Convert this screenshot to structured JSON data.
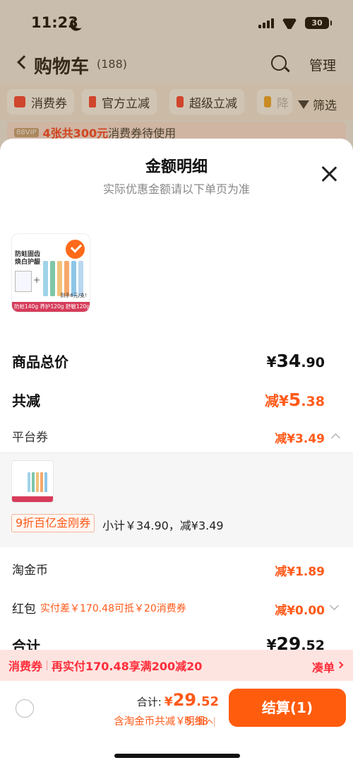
{
  "status_bar": {
    "time": "11:23",
    "battery": "30"
  },
  "nav": {
    "title": "购物车",
    "count": "(188)",
    "manage_label": "管理"
  },
  "filters": [
    {
      "label": "消费券",
      "color": "#ff3b30"
    },
    {
      "label": "官方立减",
      "color": "#ff3b30"
    },
    {
      "label": "超级立减",
      "color": "#ff3b30"
    },
    {
      "label": "降",
      "color": "#f5a623"
    }
  ],
  "filter_button": "筛选",
  "coupon_banner": {
    "vip": "88VIP",
    "highlight": "4张共300元",
    "rest": "消费券待使用"
  },
  "sheet": {
    "title": "金额明细",
    "subtitle": "实际优惠金额请以下单页为准",
    "product_thumb": {
      "headline": "防蛀固齿\n焕白护龈",
      "footer": "防蛀140g 养护120g 舒敏120g",
      "note": "到手6元/支!"
    },
    "product_total": {
      "label": "商品总价",
      "currency": "¥",
      "int": "34",
      "dec": ".90"
    },
    "total_reduce": {
      "label": "共减",
      "prefix": "减¥",
      "int": "5",
      "dec": ".38"
    },
    "platform_coupon": {
      "label": "平台券",
      "value": "减¥3.49"
    },
    "coupon_detail": {
      "tag": "9折百亿金刚券",
      "subtotal": "小计￥34.90，减¥3.49"
    },
    "taojinbi": {
      "label": "淘金币",
      "value": "减¥1.89"
    },
    "hongbao": {
      "label": "红包",
      "note": "实付差￥170.48可抵￥20消费券",
      "value": "减¥0.00"
    },
    "sum": {
      "label": "合计",
      "currency": "¥",
      "int": "29",
      "dec": ".52"
    }
  },
  "promo": {
    "tag": "消费券",
    "text": "再实付170.48享满200减20",
    "link": "凑单"
  },
  "bottom_bar": {
    "total_label": "合计:",
    "currency": "¥",
    "total_int": "29",
    "total_dec": ".52",
    "saved_text": "含淘金币共减￥5.38",
    "detail_label": "明细",
    "checkout_label": "结算(1)"
  },
  "colors": {
    "accent": "#ff5c0d",
    "promo": "#ff2d3a"
  }
}
